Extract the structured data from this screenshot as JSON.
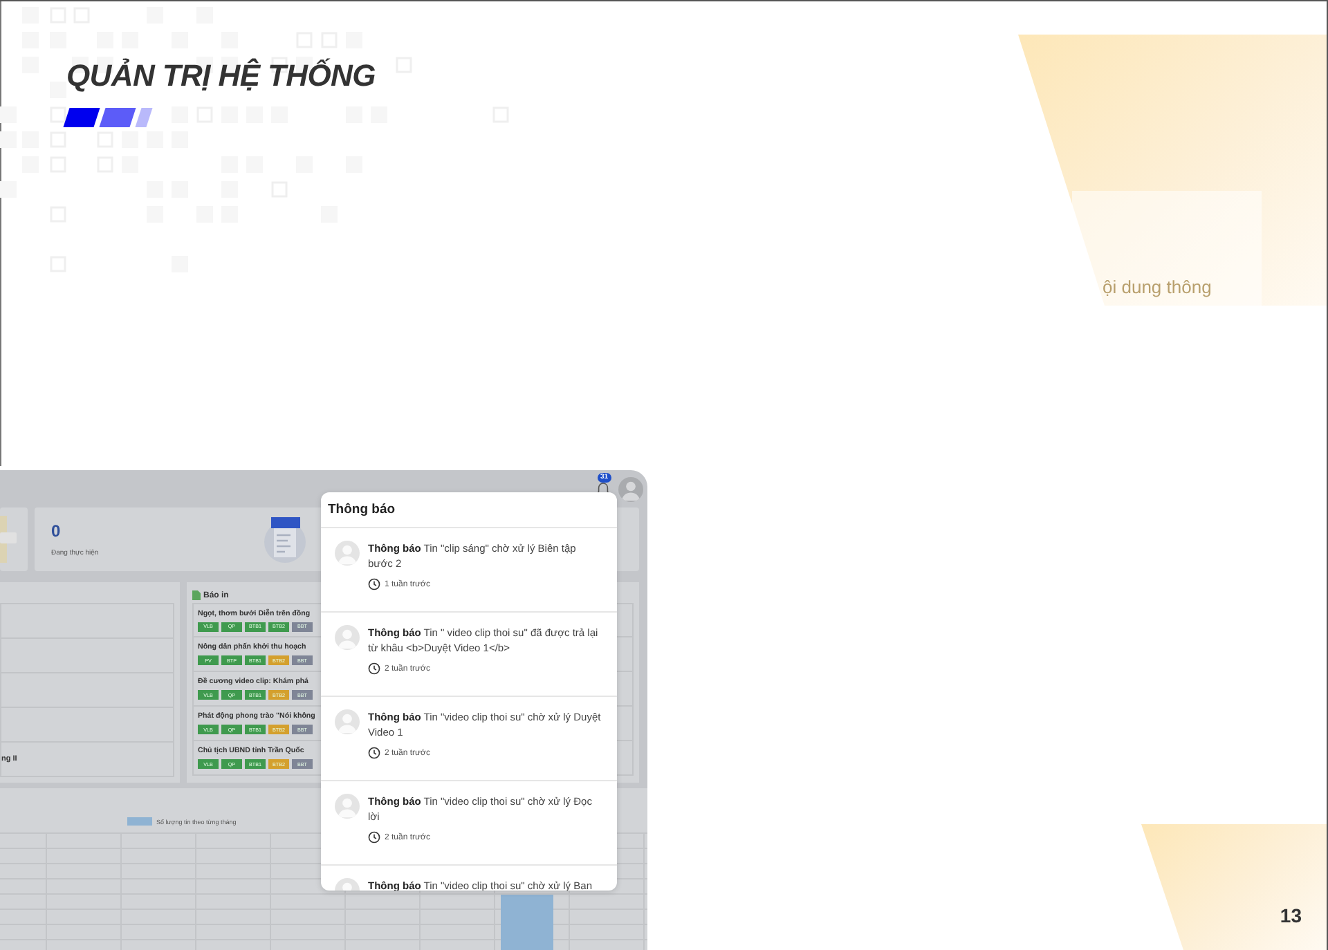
{
  "slide": {
    "title": "QUẢN TRỊ HỆ THỐNG",
    "faint_caption": "ội dung thông",
    "page_number": "13"
  },
  "screenshot": {
    "top_bar": {
      "badge": "31"
    },
    "stat_card": {
      "value": "0",
      "label": "Đang thực hiện"
    },
    "left_panel": {
      "rows": [
        "",
        "",
        "",
        "",
        "ng II"
      ]
    },
    "print_panel": {
      "title": "Báo in",
      "items": [
        {
          "title": "Ngọt, thơm bưởi Diễn trên đồng",
          "tags": [
            {
              "label": "VLB",
              "color": "#3f9a4e"
            },
            {
              "label": "QP",
              "color": "#3f9a4e"
            },
            {
              "label": "BTB1",
              "color": "#3f9a4e"
            },
            {
              "label": "BTB2",
              "color": "#3f9a4e"
            },
            {
              "label": "BBT",
              "color": "#7f8596"
            }
          ]
        },
        {
          "title": "Nông dân phấn khởi thu hoạch",
          "tags": [
            {
              "label": "PV",
              "color": "#3f9a4e"
            },
            {
              "label": "BTP",
              "color": "#3f9a4e"
            },
            {
              "label": "BTB1",
              "color": "#3f9a4e"
            },
            {
              "label": "BTB2",
              "color": "#d4a02e"
            },
            {
              "label": "BBT",
              "color": "#7f8596"
            }
          ]
        },
        {
          "title": "Đề cương video clip: Khám phá",
          "tags": [
            {
              "label": "VLB",
              "color": "#3f9a4e"
            },
            {
              "label": "QP",
              "color": "#3f9a4e"
            },
            {
              "label": "BTB1",
              "color": "#3f9a4e"
            },
            {
              "label": "BTB2",
              "color": "#d4a02e"
            },
            {
              "label": "BBT",
              "color": "#7f8596"
            }
          ]
        },
        {
          "title": "Phát động phong trào \"Nói không",
          "tags": [
            {
              "label": "VLB",
              "color": "#3f9a4e"
            },
            {
              "label": "QP",
              "color": "#3f9a4e"
            },
            {
              "label": "BTB1",
              "color": "#3f9a4e"
            },
            {
              "label": "BTB2",
              "color": "#d4a02e"
            },
            {
              "label": "BBT",
              "color": "#7f8596"
            }
          ]
        },
        {
          "title": "Chủ tịch UBND tỉnh Trần Quốc",
          "tags": [
            {
              "label": "VLB",
              "color": "#3f9a4e"
            },
            {
              "label": "QP",
              "color": "#3f9a4e"
            },
            {
              "label": "BTB1",
              "color": "#3f9a4e"
            },
            {
              "label": "BTB2",
              "color": "#d4a02e"
            },
            {
              "label": "BBT",
              "color": "#7f8596"
            }
          ]
        }
      ]
    },
    "chart": {
      "legend": "Số lượng tin theo từng tháng"
    },
    "notifications": {
      "title": "Thông báo",
      "items": [
        {
          "heading": "Thông báo",
          "text": "Tin \"clip sáng\" chờ xử lý Biên tập bước 2",
          "time": "1 tuần trước"
        },
        {
          "heading": "Thông báo",
          "text": "Tin \" video clip thoi su\" đã được trả lại từ khâu <b>Duyệt Video 1</b>",
          "time": "2 tuần trước"
        },
        {
          "heading": "Thông báo",
          "text": "Tin \"video clip thoi su\" chờ xử lý Duyệt Video 1",
          "time": "2 tuần trước"
        },
        {
          "heading": "Thông báo",
          "text": "Tin \"video clip thoi su\" chờ xử lý Đọc lời",
          "time": "2 tuần trước"
        },
        {
          "heading": "Thông báo",
          "text": "Tin \"video clip thoi su\" chờ xử lý Ban"
        }
      ]
    }
  }
}
